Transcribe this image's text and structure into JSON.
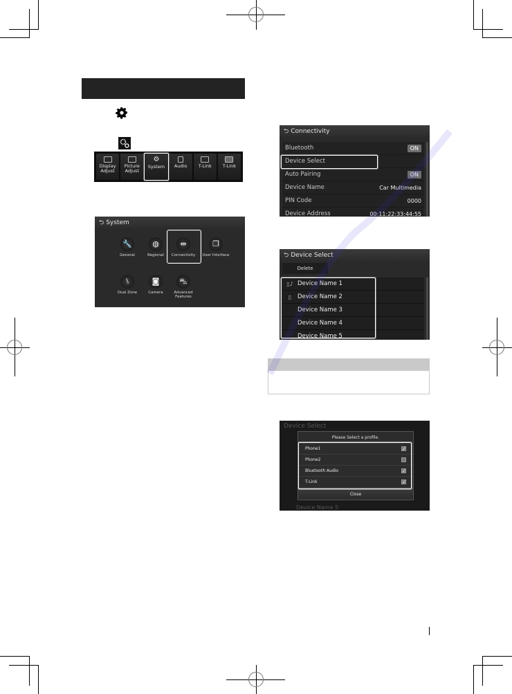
{
  "icons": {
    "settings_gear": "gear-icon",
    "system_gears": "gears-icon",
    "back": "back-arrow-icon"
  },
  "top_menu": {
    "items": [
      {
        "label_1": "Display",
        "label_2": "Adjust",
        "icon": "display-adjust-icon"
      },
      {
        "label_1": "Picture",
        "label_2": "Adjust",
        "icon": "picture-adjust-icon"
      },
      {
        "label_1": "System",
        "label_2": "",
        "icon": "gears-icon",
        "selected": true
      },
      {
        "label_1": "Audio",
        "label_2": "",
        "icon": "audio-icon"
      },
      {
        "label_1": "T-Link",
        "label_2": "",
        "icon": "tlink-icon"
      },
      {
        "label_1": "T-Link",
        "label_2": "",
        "icon": "tlink-icon"
      }
    ]
  },
  "system_screen": {
    "title": "System",
    "items": [
      {
        "label": "General",
        "icon": "wrench-icon"
      },
      {
        "label": "Regional",
        "icon": "globe-icon"
      },
      {
        "label": "Connectivity",
        "icon": "plug-icon",
        "selected": true
      },
      {
        "label": "User Interface",
        "icon": "windows-icon"
      },
      {
        "label": "Dual Zone",
        "icon": "seats-icon"
      },
      {
        "label": "Camera",
        "icon": "camera-icon"
      },
      {
        "label": "Advanced",
        "label_2": "Features",
        "icon": "car-icon"
      }
    ]
  },
  "connectivity_screen": {
    "title": "Connectivity",
    "rows": [
      {
        "label": "Bluetooth",
        "value": "ON",
        "type": "toggle"
      },
      {
        "label": "Device Select",
        "value": "",
        "type": "link",
        "highlighted": true
      },
      {
        "label": "Auto Pairing",
        "value": "ON",
        "type": "toggle"
      },
      {
        "label": "Device Name",
        "value": "Car Multimedia",
        "type": "text"
      },
      {
        "label": "PIN Code",
        "value": "0000",
        "type": "text"
      },
      {
        "label": "Device Address",
        "value": "00:11:22:33:44:55",
        "type": "text"
      }
    ]
  },
  "device_select_screen": {
    "title": "Device Select",
    "delete_label": "Delete",
    "devices": [
      {
        "name": "Device Name 1",
        "icon": "phone-audio-icon"
      },
      {
        "name": "Device Name 2",
        "icon": "phone-icon"
      },
      {
        "name": "Device Name 3",
        "icon": ""
      },
      {
        "name": "Device Name 4",
        "icon": ""
      },
      {
        "name": "Device Name 5",
        "icon": ""
      }
    ]
  },
  "profile_dialog": {
    "bg_title": "Device Select",
    "bg_footer": "Device Name 5",
    "title": "Please Select a profile.",
    "profiles": [
      {
        "label": "Phone1",
        "checked": true
      },
      {
        "label": "Phone2",
        "checked": false
      },
      {
        "label": "Bluetooth Audio",
        "checked": true
      },
      {
        "label": "T-Link",
        "checked": true
      }
    ],
    "close_label": "Close"
  },
  "colors": {
    "screen_bg": "#2a2a2a",
    "section_bar": "#232323",
    "note_header": "#c9c9c9",
    "highlight": "#ffffff"
  }
}
